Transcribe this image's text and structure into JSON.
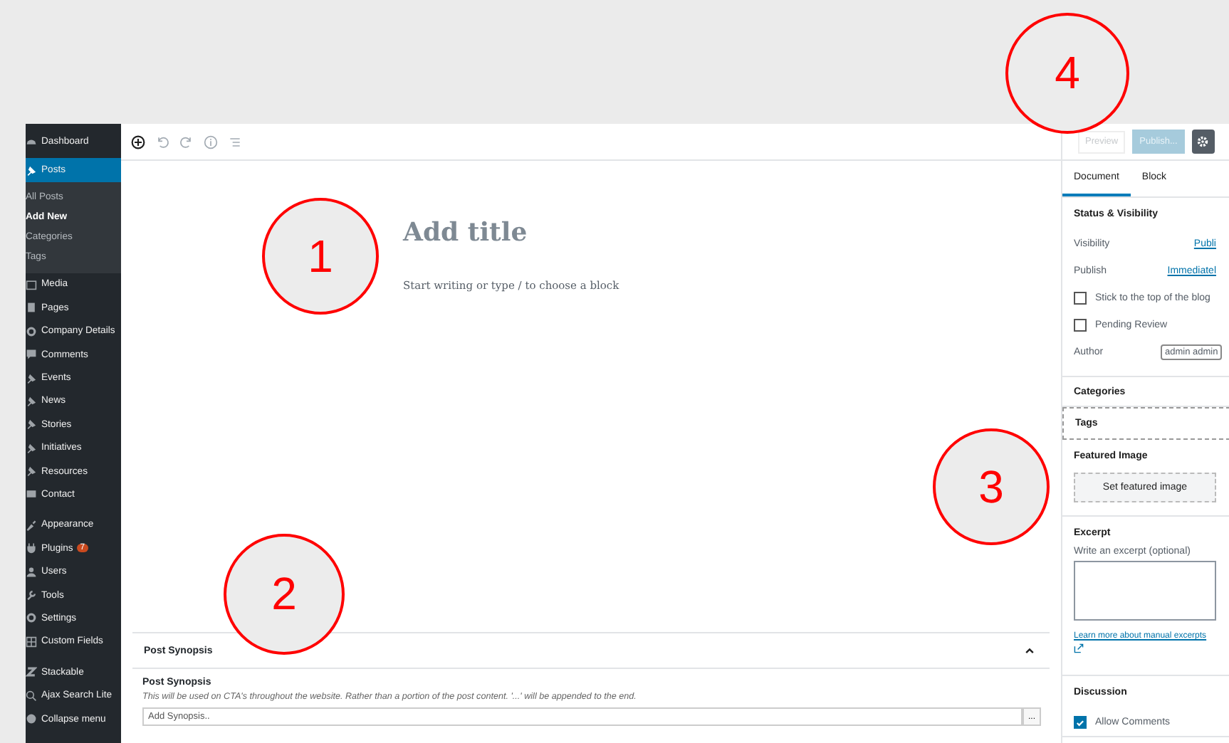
{
  "sidebar": {
    "items": [
      {
        "label": "Dashboard",
        "selected": false
      },
      {
        "label": "Posts",
        "selected": true,
        "children": [
          {
            "label": "All Posts",
            "selected": false
          },
          {
            "label": "Add New",
            "selected": true
          },
          {
            "label": "Categories",
            "selected": false
          },
          {
            "label": "Tags",
            "selected": false
          }
        ]
      },
      {
        "label": "Media",
        "selected": false
      },
      {
        "label": "Pages",
        "selected": false
      },
      {
        "label": "Company Details",
        "selected": false
      },
      {
        "label": "Comments",
        "selected": false
      },
      {
        "label": "Events",
        "selected": false
      },
      {
        "label": "News",
        "selected": false
      },
      {
        "label": "Stories",
        "selected": false
      },
      {
        "label": "Initiatives",
        "selected": false
      },
      {
        "label": "Resources",
        "selected": false
      },
      {
        "label": "Contact",
        "selected": false
      },
      {
        "label": "Appearance",
        "selected": false
      },
      {
        "label": "Plugins",
        "selected": false,
        "badge": "7"
      },
      {
        "label": "Users",
        "selected": false
      },
      {
        "label": "Tools",
        "selected": false
      },
      {
        "label": "Settings",
        "selected": false
      },
      {
        "label": "Custom Fields",
        "selected": false
      },
      {
        "label": "Stackable",
        "selected": false
      },
      {
        "label": "Ajax Search Lite",
        "selected": false
      },
      {
        "label": "Collapse menu",
        "selected": false
      }
    ]
  },
  "editor": {
    "title_placeholder": "Add title",
    "body_placeholder": "Start writing or type / to choose a block"
  },
  "meta_box": {
    "title": "Post Synopsis",
    "field_label": "Post Synopsis",
    "description": "This will be used on CTA's throughout the website. Rather than a portion of the post content. '...' will be appended to the end.",
    "placeholder": "Add Synopsis..",
    "button": "..."
  },
  "top_bar": {
    "preview": "Preview",
    "publish": "Publish..."
  },
  "settings_panel": {
    "tabs": [
      {
        "label": "Document",
        "selected": true
      },
      {
        "label": "Block",
        "selected": false
      }
    ],
    "status": {
      "title": "Status & Visibility",
      "visibility_label": "Visibility",
      "visibility_value": "Publi",
      "publish_label": "Publish",
      "publish_value": "Immediatel",
      "checkboxes": [
        {
          "label": "Stick to the top of the blog",
          "checked": false
        },
        {
          "label": "Pending Review",
          "checked": false
        }
      ],
      "author_label": "Author",
      "author_value": "admin admin"
    },
    "categories": "Categories",
    "tags": "Tags",
    "featured_image": {
      "title": "Featured Image",
      "button": "Set featured image"
    },
    "excerpt": {
      "title": "Excerpt",
      "label": "Write an excerpt (optional)",
      "link": "Learn more about manual excerpts"
    },
    "discussion": {
      "title": "Discussion",
      "checkboxes": [
        {
          "label": "Allow Comments",
          "checked": true
        }
      ]
    }
  },
  "annotations": [
    "1",
    "2",
    "3",
    "4"
  ]
}
